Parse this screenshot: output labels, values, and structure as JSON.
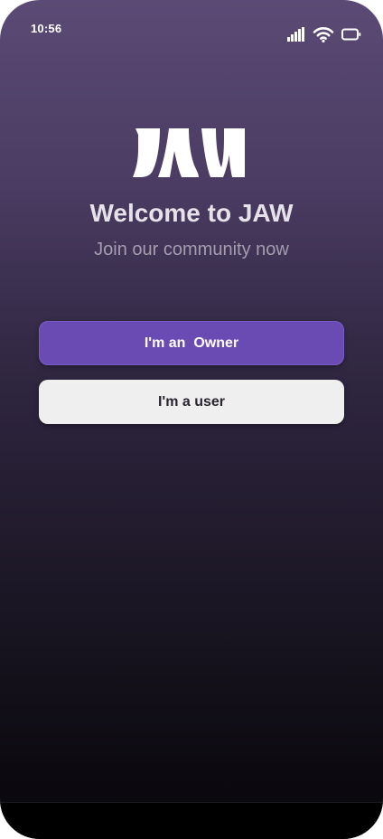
{
  "status_bar": {
    "time": "10:56",
    "icons": [
      "cellular-signal-icon",
      "wifi-icon",
      "battery-icon"
    ]
  },
  "brand": {
    "logo_text": "JAW",
    "logo_color": "#ffffff"
  },
  "welcome": {
    "title": "Welcome to JAW",
    "subtitle": "Join our community now"
  },
  "actions": {
    "owner_label": "I'm an  Owner",
    "user_label": "I'm a user"
  },
  "colors": {
    "accent": "#6a4ab3",
    "secondary_button": "#efefef",
    "background_top": "#5b4a75",
    "background_bottom": "#08070b"
  }
}
